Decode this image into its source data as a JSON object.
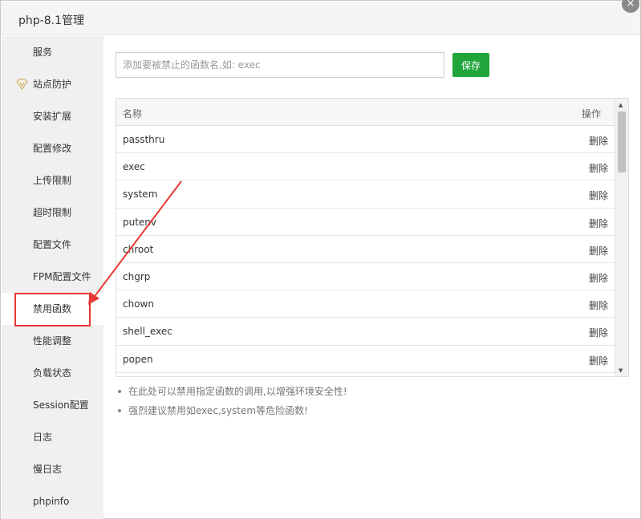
{
  "window": {
    "title": "php-8.1管理",
    "close_glyph": "×"
  },
  "sidebar": {
    "items": [
      {
        "label": "服务",
        "active": false
      },
      {
        "label": "站点防护",
        "active": false,
        "icon": "shield-icon"
      },
      {
        "label": "安装扩展",
        "active": false
      },
      {
        "label": "配置修改",
        "active": false
      },
      {
        "label": "上传限制",
        "active": false
      },
      {
        "label": "超时限制",
        "active": false
      },
      {
        "label": "配置文件",
        "active": false
      },
      {
        "label": "FPM配置文件",
        "active": false
      },
      {
        "label": "禁用函数",
        "active": true
      },
      {
        "label": "性能调整",
        "active": false
      },
      {
        "label": "负载状态",
        "active": false
      },
      {
        "label": "Session配置",
        "active": false
      },
      {
        "label": "日志",
        "active": false
      },
      {
        "label": "慢日志",
        "active": false
      },
      {
        "label": "phpinfo",
        "active": false
      }
    ]
  },
  "toolbar": {
    "input_placeholder": "添加要被禁止的函数名,如: exec",
    "input_value": "",
    "save_label": "保存"
  },
  "table": {
    "headers": {
      "name": "名称",
      "action": "操作"
    },
    "rows": [
      {
        "name": "passthru",
        "action": "删除"
      },
      {
        "name": "exec",
        "action": "删除"
      },
      {
        "name": "system",
        "action": "删除"
      },
      {
        "name": "putenv",
        "action": "删除"
      },
      {
        "name": "chroot",
        "action": "删除"
      },
      {
        "name": "chgrp",
        "action": "删除"
      },
      {
        "name": "chown",
        "action": "删除"
      },
      {
        "name": "shell_exec",
        "action": "删除"
      },
      {
        "name": "popen",
        "action": "删除"
      },
      {
        "name": "",
        "action": ""
      }
    ]
  },
  "tips": [
    "在此处可以禁用指定函数的调用,以增强环境安全性!",
    "强烈建议禁用如exec,system等危险函数!"
  ],
  "colors": {
    "accent": "#20a53a",
    "annotation": "#e53935",
    "sidebar_bg": "#f0f0f0"
  }
}
